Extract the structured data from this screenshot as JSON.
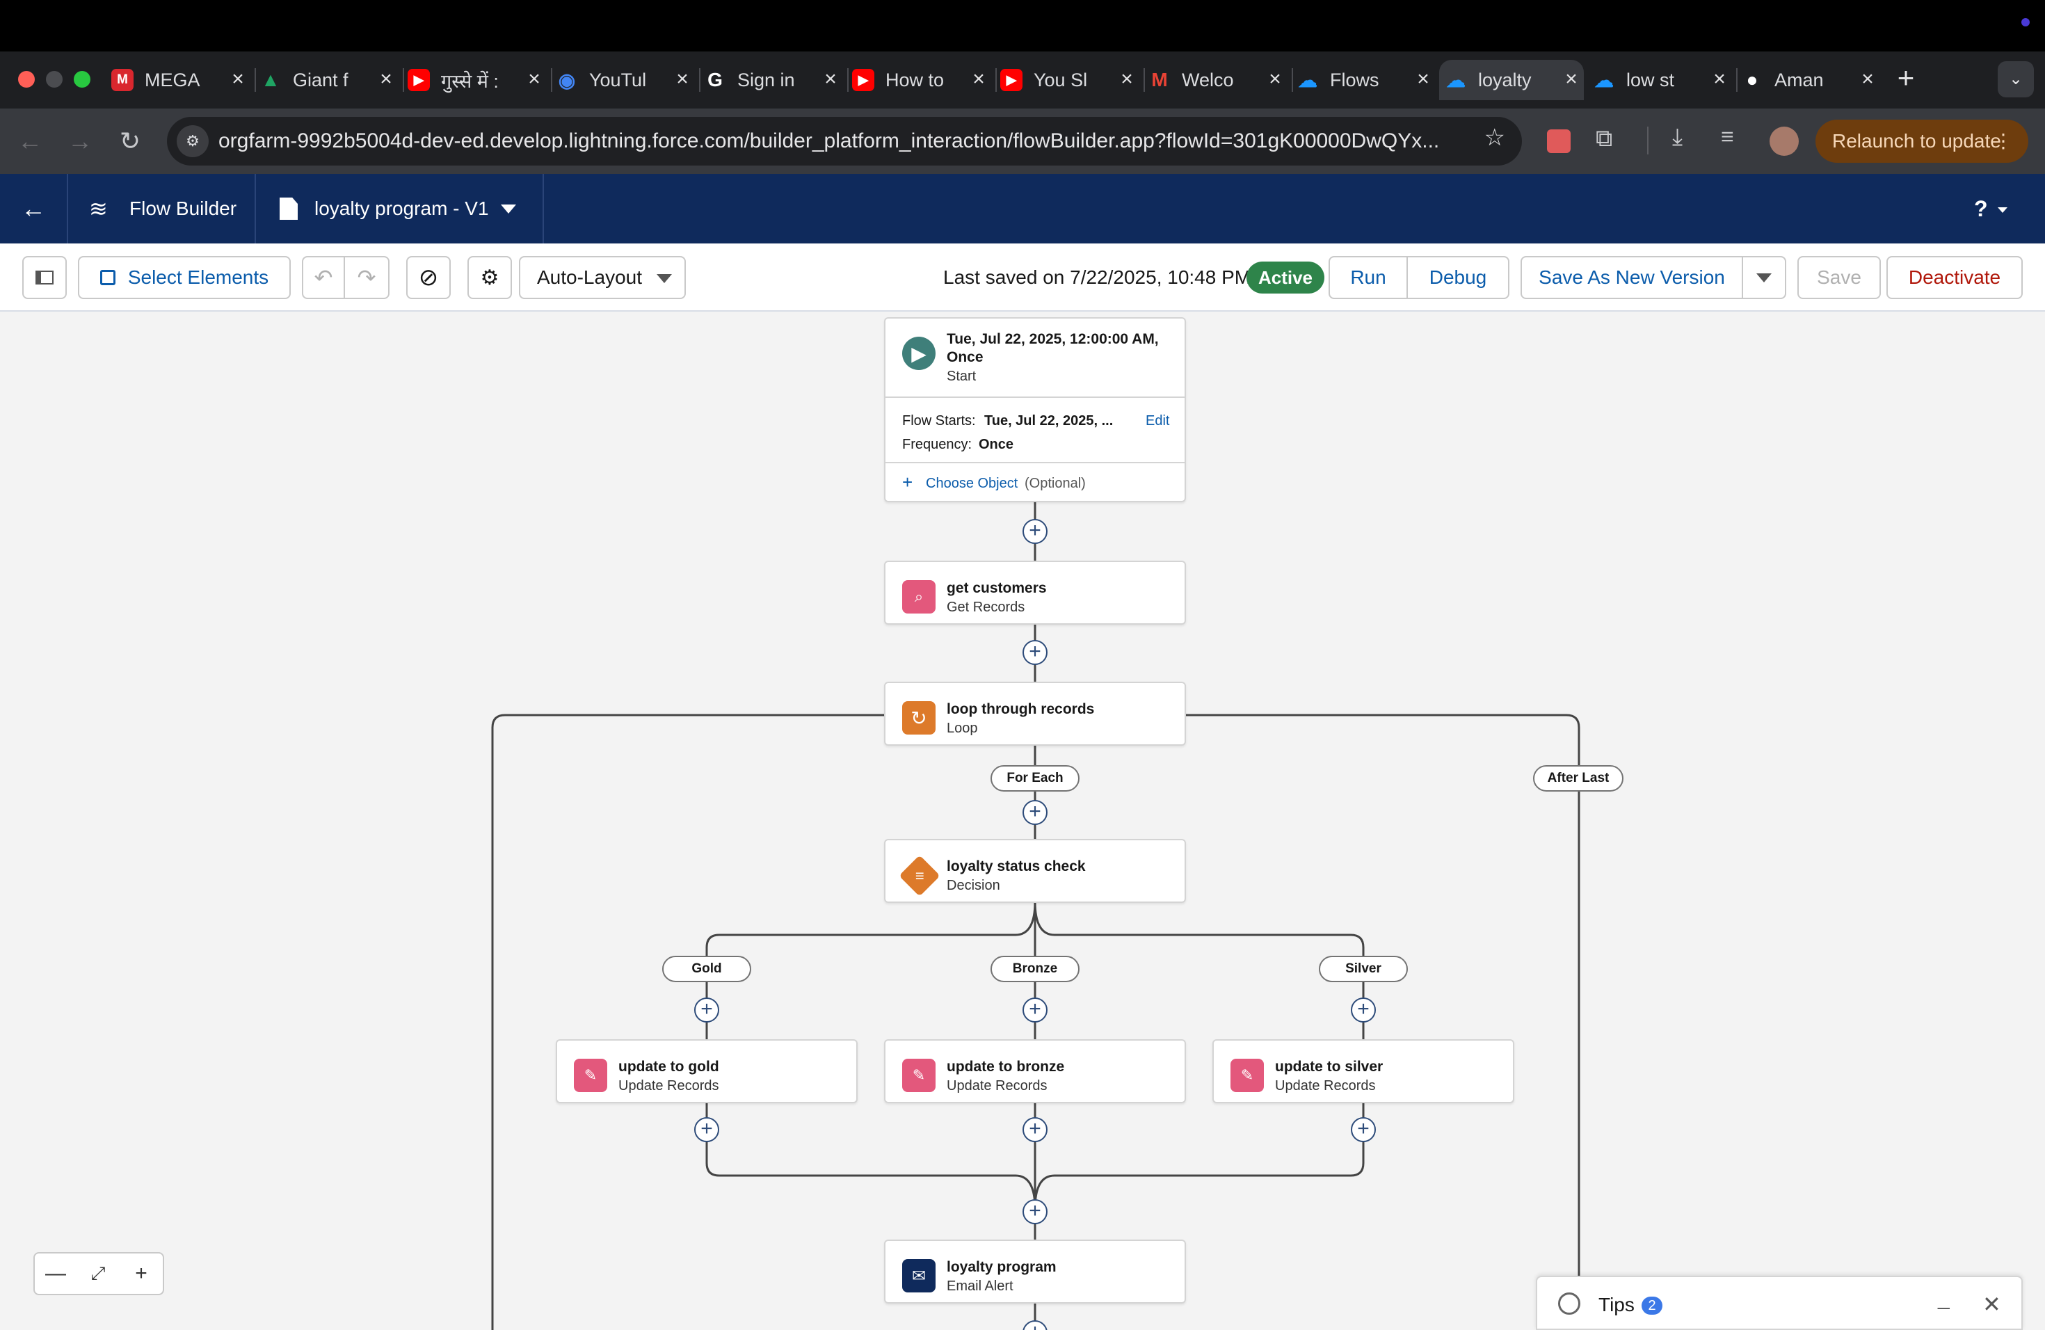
{
  "browser": {
    "tabs": [
      {
        "title": "MEGA",
        "icon": "mega-icon",
        "color": "#d9272e"
      },
      {
        "title": "Giant f",
        "icon": "google-drive-icon",
        "color": "#1fa463"
      },
      {
        "title": "गुस्से में :",
        "icon": "youtube-icon",
        "color": "#ff0000"
      },
      {
        "title": "YouTul",
        "icon": "google-app-icon",
        "color": "#4285f4"
      },
      {
        "title": "Sign in",
        "icon": "google-icon",
        "color": "#ffffff"
      },
      {
        "title": "How to",
        "icon": "youtube-icon",
        "color": "#ff0000"
      },
      {
        "title": "You Sl",
        "icon": "youtube-icon",
        "color": "#ff0000"
      },
      {
        "title": "Welco",
        "icon": "gmail-icon",
        "color": "#ea4335"
      },
      {
        "title": "Flows",
        "icon": "salesforce-icon",
        "color": "#1b96ff"
      },
      {
        "title": "loyalty",
        "icon": "salesforce-icon",
        "color": "#1b96ff",
        "active": true
      },
      {
        "title": "low st",
        "icon": "salesforce-icon",
        "color": "#1b96ff"
      },
      {
        "title": "Aman",
        "icon": "github-icon",
        "color": "#ffffff"
      }
    ],
    "url": "orgfarm-9992b5004d-dev-ed.develop.lightning.force.com/builder_platform_interaction/flowBuilder.app?flowId=301gK00000DwQYx...",
    "relaunch_label": "Relaunch to update"
  },
  "header": {
    "app_name": "Flow Builder",
    "flow_name": "loyalty program - V1",
    "help": "?"
  },
  "toolbar": {
    "select_elements": "Select Elements",
    "layout_mode": "Auto-Layout",
    "last_saved": "Last saved on 7/22/2025, 10:48 PM",
    "status": "Active",
    "run": "Run",
    "debug": "Debug",
    "save_as_new": "Save As New Version",
    "save": "Save",
    "deactivate": "Deactivate"
  },
  "start": {
    "title_line1": "Tue, Jul 22, 2025, 12:00:00 AM,",
    "title_line2": "Once",
    "subtitle": "Start",
    "flow_starts_label": "Flow Starts:",
    "flow_starts_value": "Tue, Jul 22, 2025, ...",
    "edit": "Edit",
    "frequency_label": "Frequency:",
    "frequency_value": "Once",
    "choose_object": "Choose Object",
    "optional": "(Optional)"
  },
  "nodes": {
    "get_customers": {
      "title": "get customers",
      "type": "Get Records"
    },
    "loop": {
      "title": "loop through records",
      "type": "Loop"
    },
    "decision": {
      "title": "loyalty status check",
      "type": "Decision"
    },
    "gold": {
      "title": "update to gold",
      "type": "Update Records"
    },
    "bronze": {
      "title": "update to bronze",
      "type": "Update Records"
    },
    "silver": {
      "title": "update to silver",
      "type": "Update Records"
    },
    "email": {
      "title": "loyalty program",
      "type": "Email Alert"
    }
  },
  "connectors": {
    "for_each": "For Each",
    "after_last": "After Last",
    "gold": "Gold",
    "bronze": "Bronze",
    "silver": "Silver"
  },
  "tips": {
    "label": "Tips",
    "count": "2"
  }
}
